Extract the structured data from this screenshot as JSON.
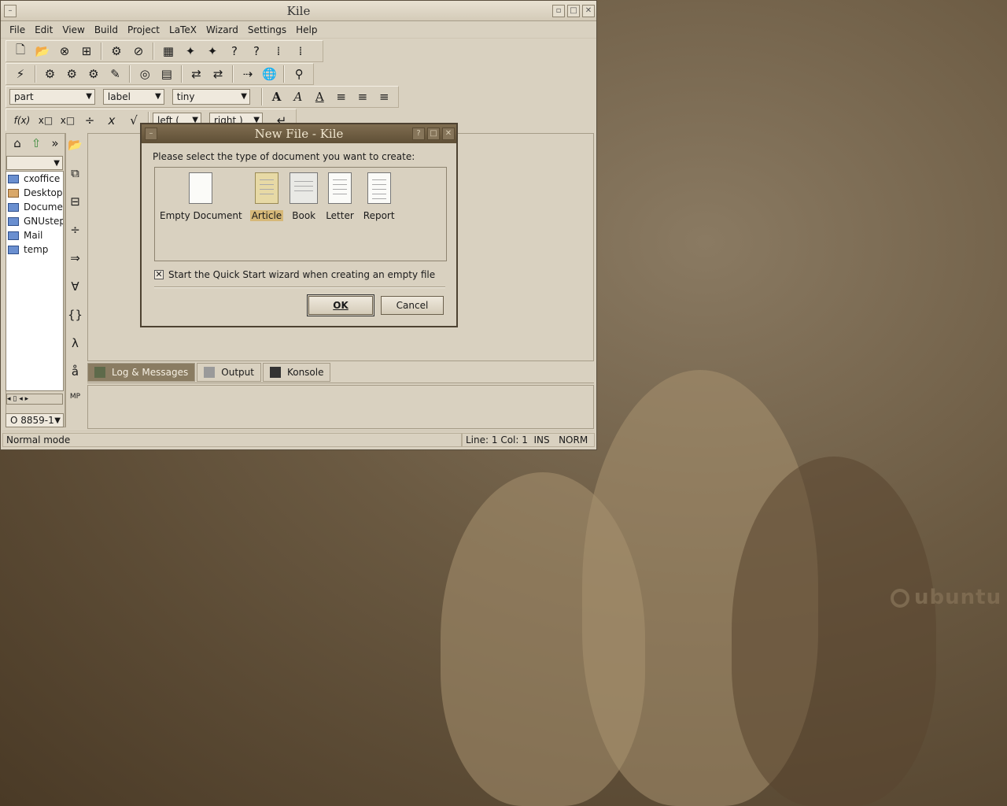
{
  "window": {
    "title": "Kile"
  },
  "menu": [
    "File",
    "Edit",
    "View",
    "Build",
    "Project",
    "LaTeX",
    "Wizard",
    "Settings",
    "Help"
  ],
  "toolbar_format": {
    "section_combo": "part",
    "label_combo": "label",
    "size_combo": "tiny"
  },
  "toolbar_math": {
    "left_combo": "left (",
    "right_combo": "right )"
  },
  "sidebar": {
    "path_combo": "",
    "files": [
      "cxoffice",
      "Desktop",
      "Documents",
      "GNUstep",
      "Mail",
      "temp"
    ],
    "encoding": "O 8859-1"
  },
  "bottom_tabs": [
    "Log & Messages",
    "Output",
    "Konsole"
  ],
  "status": {
    "mode": "Normal mode",
    "position": "Line: 1 Col: 1  INS   NORM"
  },
  "dialog": {
    "title": "New File - Kile",
    "prompt": "Please select the type of document you want to create:",
    "templates": [
      "Empty Document",
      "Article",
      "Book",
      "Letter",
      "Report"
    ],
    "selected": "Article",
    "checkbox_label": "Start the Quick Start wizard when creating an empty file",
    "checkbox_checked": true,
    "ok_label": "OK",
    "cancel_label": "Cancel"
  },
  "wallpaper": {
    "brand": "ubuntu"
  }
}
